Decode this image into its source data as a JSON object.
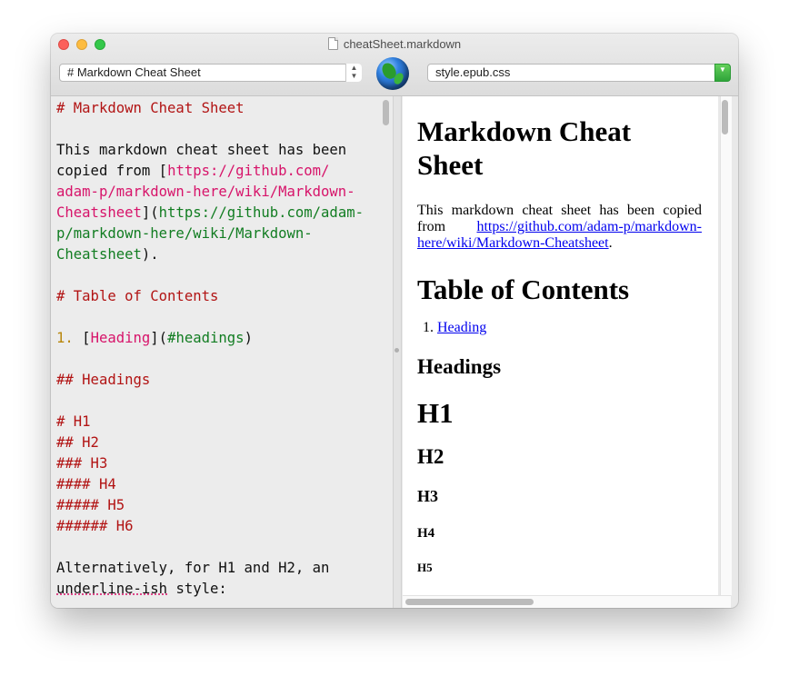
{
  "window": {
    "title": "cheatSheet.markdown"
  },
  "toolbar": {
    "heading_select": "# Markdown Cheat Sheet",
    "stylesheet_select": "style.epub.css"
  },
  "editor": {
    "l1": "# Markdown Cheat Sheet",
    "l2": "This markdown cheat sheet has been",
    "l3a": "copied from [",
    "l3b": "https://github.com/",
    "l4": "adam-p/markdown-here/wiki/Markdown-",
    "l5a": "Cheatsheet",
    "l5b": "](",
    "l5c": "https://github.com/adam-",
    "l6": "p/markdown-here/wiki/Markdown-",
    "l7a": "Cheatsheet",
    "l7b": ").",
    "l8": "# Table of Contents",
    "l9a": "1.",
    "l9b": " [",
    "l9c": "Heading",
    "l9d": "](",
    "l9e": "#headings",
    "l9f": ")",
    "l10": "## Headings",
    "l11": "# H1",
    "l12": "## H2",
    "l13": "### H3",
    "l14": "#### H4",
    "l15": "##### H5",
    "l16": "###### H6",
    "l17": "Alternatively, for H1 and H2, an",
    "l18a": "underline-ish",
    "l18b": " style:"
  },
  "preview": {
    "title": "Markdown Cheat Sheet",
    "intro": "This markdown cheat sheet has been copied from ",
    "intro_link": "https://github.com/adam-p/markdown-here/wiki/Markdown-Cheatsheet",
    "intro_end": ".",
    "toc_title": "Table of Contents",
    "toc_item": "Heading",
    "headings": "Headings",
    "h1": "H1",
    "h2": "H2",
    "h3": "H3",
    "h4": "H4",
    "h5": "H5"
  },
  "colors": {
    "heading_markup": "#b21414",
    "link_text": "#d7146a",
    "url": "#127d22",
    "list_number": "#b8860b",
    "preview_link": "#0000ee"
  }
}
